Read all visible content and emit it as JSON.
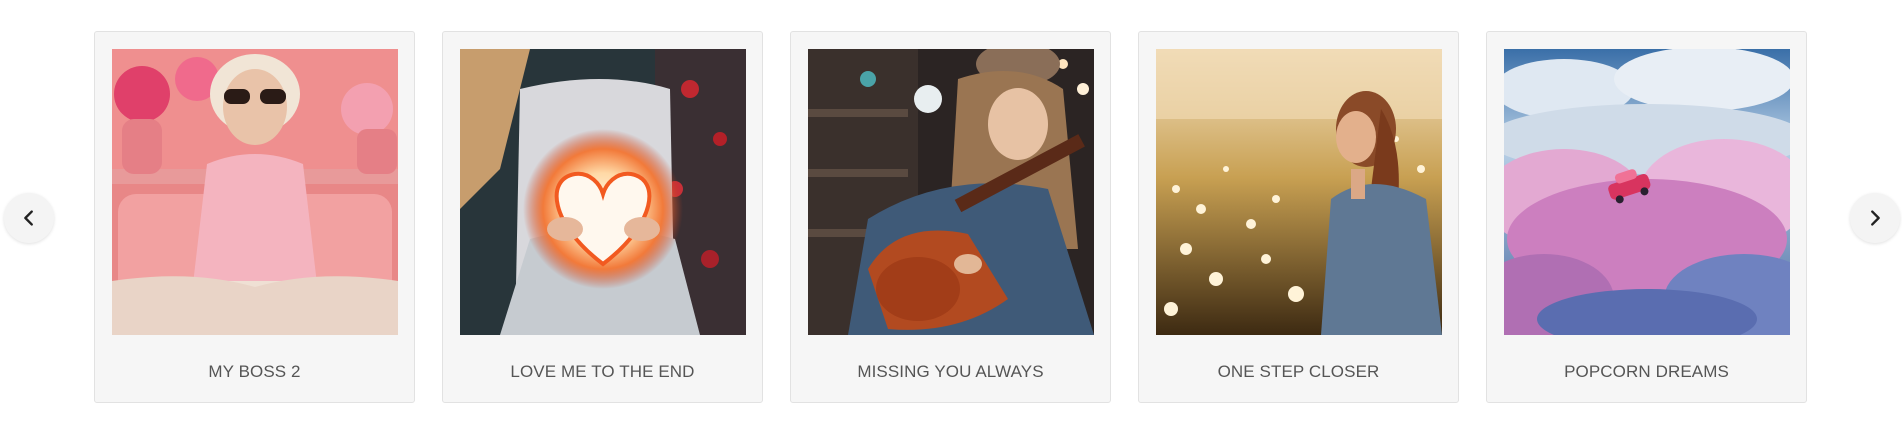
{
  "carousel": {
    "prev_icon": "chevron-left-icon",
    "next_icon": "chevron-right-icon",
    "items": [
      {
        "title": "MY BOSS 2",
        "image": "woman-in-pink-sunglasses-cover"
      },
      {
        "title": "LOVE ME TO THE END",
        "image": "glowing-heart-cover"
      },
      {
        "title": "MISSING YOU ALWAYS",
        "image": "girl-playing-guitar-cover"
      },
      {
        "title": "ONE STEP CLOSER",
        "image": "woman-in-flower-field-cover"
      },
      {
        "title": "POPCORN DREAMS",
        "image": "car-in-pink-clouds-cover"
      }
    ]
  },
  "colors": {
    "card_background": "#f6f6f6",
    "card_border": "#e2e2e2",
    "title_text": "#555555",
    "arrow_background": "#f4f4f4"
  }
}
